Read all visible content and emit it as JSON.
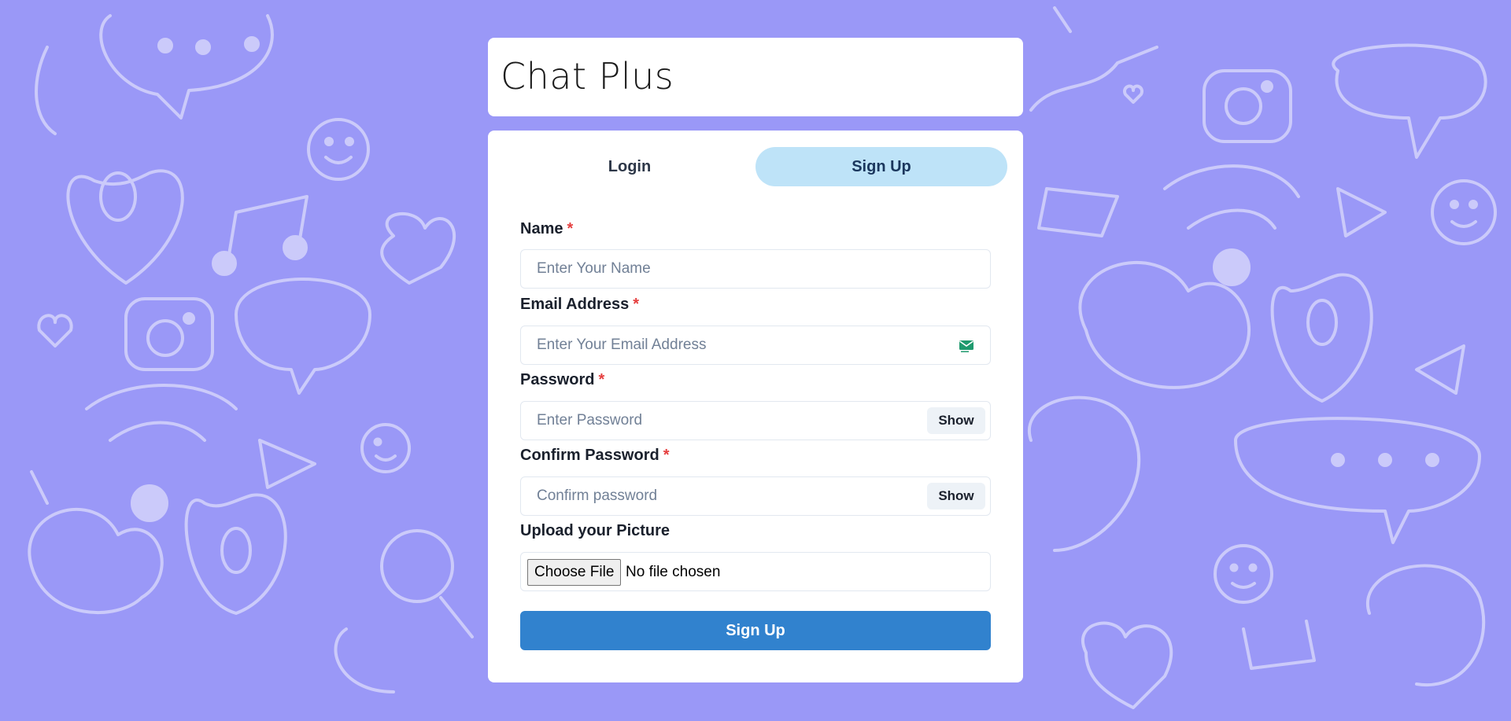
{
  "app": {
    "title": "Chat Plus",
    "background_color": "#9a98f7",
    "accent_color": "#3182ce"
  },
  "tabs": [
    {
      "label": "Login",
      "active": false
    },
    {
      "label": "Sign Up",
      "active": true
    }
  ],
  "form": {
    "name": {
      "label": "Name",
      "required_marker": "*",
      "placeholder": "Enter Your Name",
      "value": ""
    },
    "email": {
      "label": "Email Address",
      "required_marker": "*",
      "placeholder": "Enter Your Email Address",
      "value": "",
      "icon": "email-envelope-icon"
    },
    "password": {
      "label": "Password",
      "required_marker": "*",
      "placeholder": "Enter Password",
      "value": "",
      "toggle_label": "Show"
    },
    "confirm_password": {
      "label": "Confirm Password",
      "required_marker": "*",
      "placeholder": "Confirm password",
      "value": "",
      "toggle_label": "Show"
    },
    "picture": {
      "label": "Upload your Picture",
      "button_label": "Choose File",
      "status": "No file chosen"
    },
    "submit_label": "Sign Up"
  }
}
